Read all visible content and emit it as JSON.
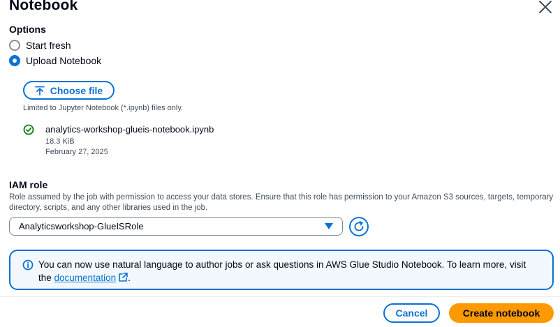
{
  "modal": {
    "title": "Notebook",
    "close_icon": "close-icon"
  },
  "options": {
    "label": "Options",
    "items": [
      {
        "label": "Start fresh",
        "selected": false
      },
      {
        "label": "Upload Notebook",
        "selected": true
      }
    ]
  },
  "upload": {
    "button_label": "Choose file",
    "button_icon": "upload-icon",
    "hint": "Limited to Jupyter Notebook (*.ipynb) files only.",
    "file": {
      "status_icon": "success-check-icon",
      "name": "analytics-workshop-glueis-notebook.ipynb",
      "size": "18.3 KiB",
      "date": "February 27, 2025"
    }
  },
  "iam_role": {
    "label": "IAM role",
    "description": "Role assumed by the job with permission to access your data stores. Ensure that this role has permission to your Amazon S3 sources, targets, temporary directory, scripts, and any other libraries used in the job.",
    "selected_value": "Analyticsworkshop-GlueISRole",
    "dropdown_icon": "caret-down-icon",
    "refresh_icon": "refresh-icon"
  },
  "info": {
    "icon": "info-icon",
    "text_before": "You can now use natural language to author jobs or ask questions in AWS Glue Studio Notebook. To learn more, visit the ",
    "link_text": "documentation",
    "text_after": ".",
    "link_icon": "external-link-icon"
  },
  "footer": {
    "cancel_label": "Cancel",
    "create_label": "Create notebook"
  },
  "colors": {
    "accent": "#0972d3",
    "primary_button": "#ff9900",
    "success": "#037f0c",
    "info_background": "#f2f8fd"
  }
}
